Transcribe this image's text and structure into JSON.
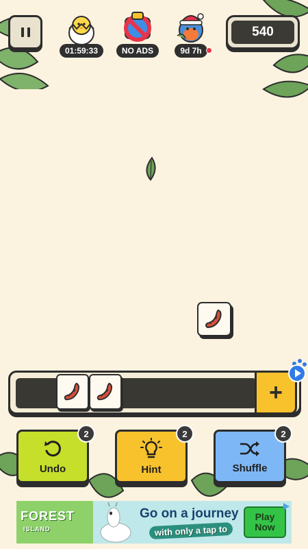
{
  "header": {
    "pause_icon": "pause-icon",
    "timer": "01:59:33",
    "no_ads": "NO ADS",
    "event_time": "9d 7h",
    "score": "540"
  },
  "board": {
    "tiles": [
      {
        "item": "sausage"
      }
    ],
    "falling_leaf": "leaf-icon"
  },
  "tray": {
    "tiles": [
      "sausage",
      "sausage"
    ],
    "slots": 7,
    "add_slot_label": "+"
  },
  "powerups": [
    {
      "label": "Undo",
      "count": "2",
      "color": "#c6df2a",
      "icon": "undo-icon"
    },
    {
      "label": "Hint",
      "count": "2",
      "color": "#f7c22c",
      "icon": "lightbulb-icon"
    },
    {
      "label": "Shuffle",
      "count": "2",
      "color": "#7eb7f5",
      "icon": "shuffle-icon"
    }
  ],
  "ad": {
    "brand": "FOREST",
    "brand_sub": "ISLAND",
    "headline": "Go on a journey",
    "tagline": "with only a tap to",
    "cta_line1": "Play",
    "cta_line2": "Now"
  }
}
